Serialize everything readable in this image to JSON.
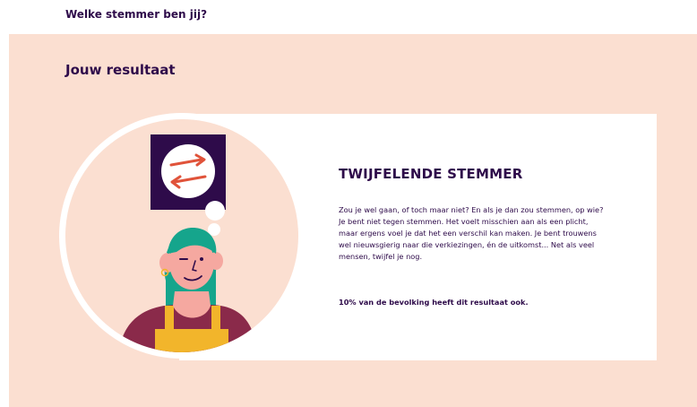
{
  "header": {
    "title": "Welke stemmer ben jij?"
  },
  "result": {
    "heading": "Jouw resultaat",
    "type_title": "TWIJFELENDE STEMMER",
    "description": "Zou je wel gaan, of toch maar niet? En als je dan zou stemmen, op wie? Je bent niet tegen stemmen. Het voelt misschien aan als een plicht, maar ergens voel je dat het een verschil kan maken. Je bent trouwens wel nieuwsgierig naar die verkiezingen, én de uitkomst... Net als veel mensen, twijfel je nog.",
    "statistic": "10% van de bevolking heeft dit resultaat ook."
  },
  "colors": {
    "panel_bg": "#fbdfd1",
    "text_dark_purple": "#2e0b4a",
    "hair_teal": "#15a58c",
    "shirt_maroon": "#8a2a4a",
    "apron_yellow": "#f2b52b",
    "arrow_red": "#e0533a"
  },
  "icons": {
    "illustration": "thinking-person-with-swap-arrows-icon"
  }
}
